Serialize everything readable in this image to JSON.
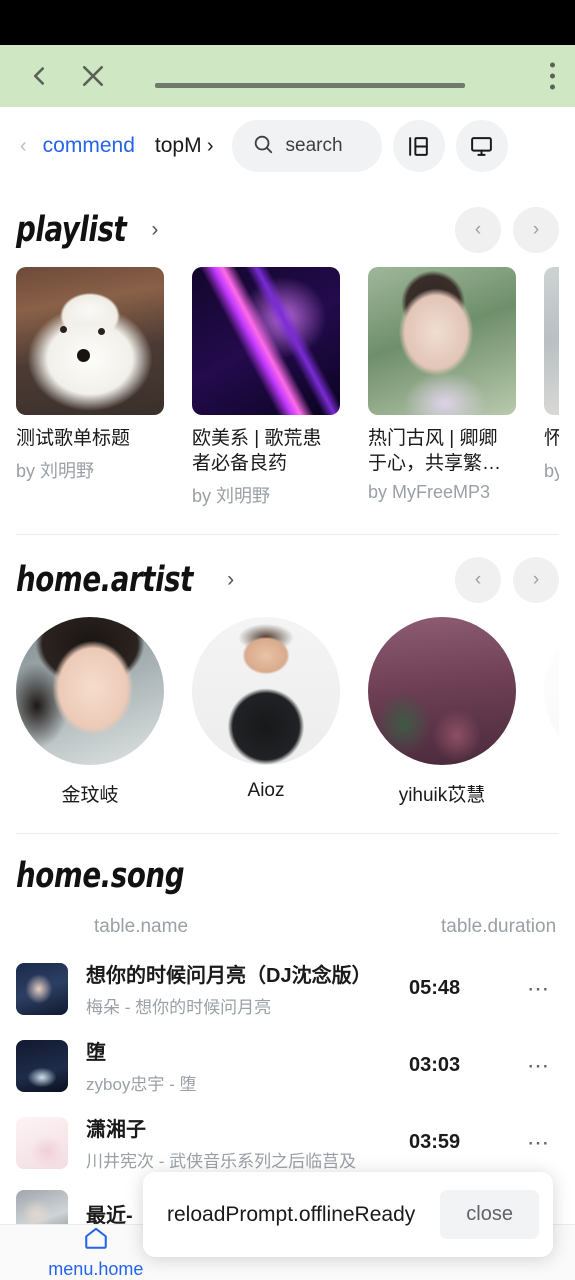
{
  "browser": {
    "back_icon": "chevron-left-icon",
    "close_icon": "close-icon",
    "menu_icon": "more-vertical-icon",
    "url_value": ""
  },
  "tabs": {
    "scroll_left_icon": "chevron-left-icon",
    "scroll_right_icon": "chevron-right-icon",
    "items": [
      {
        "label": "commend",
        "active": true
      },
      {
        "label": "topM",
        "active": false
      }
    ],
    "search": {
      "label": "search",
      "icon": "search-icon"
    },
    "actions": [
      {
        "name": "layout-toggle",
        "icon": "sidebar-icon"
      },
      {
        "name": "desktop-mode",
        "icon": "monitor-icon"
      }
    ]
  },
  "playlist_section": {
    "title": "playlist",
    "arrow_icon": "chevron-right-icon",
    "prev_icon": "chevron-left-icon",
    "next_icon": "chevron-right-icon",
    "by_prefix": "by",
    "items": [
      {
        "title": "测试歌单标题",
        "author": "by 刘明野",
        "cover": "cov-dog"
      },
      {
        "title": "欧美系 | 歌荒患者必备良药",
        "author": "by 刘明野",
        "cover": "cov-neon"
      },
      {
        "title": "热门古风 | 卿卿于心，共享繁…",
        "author": "by MyFreeMP3",
        "cover": "cov-hanfu"
      },
      {
        "title": "怀旧 | 时",
        "author": "by 刘",
        "cover": "cov-pale"
      }
    ]
  },
  "artist_section": {
    "title": "home.artist",
    "arrow_icon": "chevron-right-icon",
    "prev_icon": "chevron-left-icon",
    "next_icon": "chevron-right-icon",
    "items": [
      {
        "name": "金玟岐",
        "avatar": "av-1"
      },
      {
        "name": "Aioz",
        "avatar": "av-2"
      },
      {
        "name": "yihuik苡慧",
        "avatar": "av-3"
      },
      {
        "name": "",
        "avatar": "av-4"
      }
    ]
  },
  "song_section": {
    "title": "home.song",
    "columns": {
      "name": "table.name",
      "duration": "table.duration"
    },
    "more_icon": "more-horizontal-icon",
    "rows": [
      {
        "title": "想你的时候问月亮（DJ沈念版）",
        "subtitle": "梅朵 - 想你的时候问月亮",
        "duration": "05:48",
        "thumb": "th-1"
      },
      {
        "title": "堕",
        "subtitle": "zyboy忠宇 - 堕",
        "duration": "03:03",
        "thumb": "th-2"
      },
      {
        "title": "潇湘子",
        "subtitle": "川井宪次 - 武侠音乐系列之后临莒及",
        "duration": "03:59",
        "thumb": "th-3"
      },
      {
        "title": "最近-",
        "subtitle": "",
        "duration": "",
        "thumb": "th-4"
      }
    ]
  },
  "toast": {
    "message": "reloadPrompt.offlineReady",
    "close_label": "close"
  },
  "bottom_nav": {
    "items": [
      {
        "label": "menu.home",
        "icon": "home-icon",
        "active": true
      },
      {
        "label": "",
        "icon": "compass-icon",
        "active": false
      },
      {
        "label": "",
        "icon": "library-icon",
        "active": false
      }
    ]
  },
  "colors": {
    "accent": "#2463eb",
    "browser_bar": "#cfe7c2",
    "muted": "#9aa0a6"
  }
}
